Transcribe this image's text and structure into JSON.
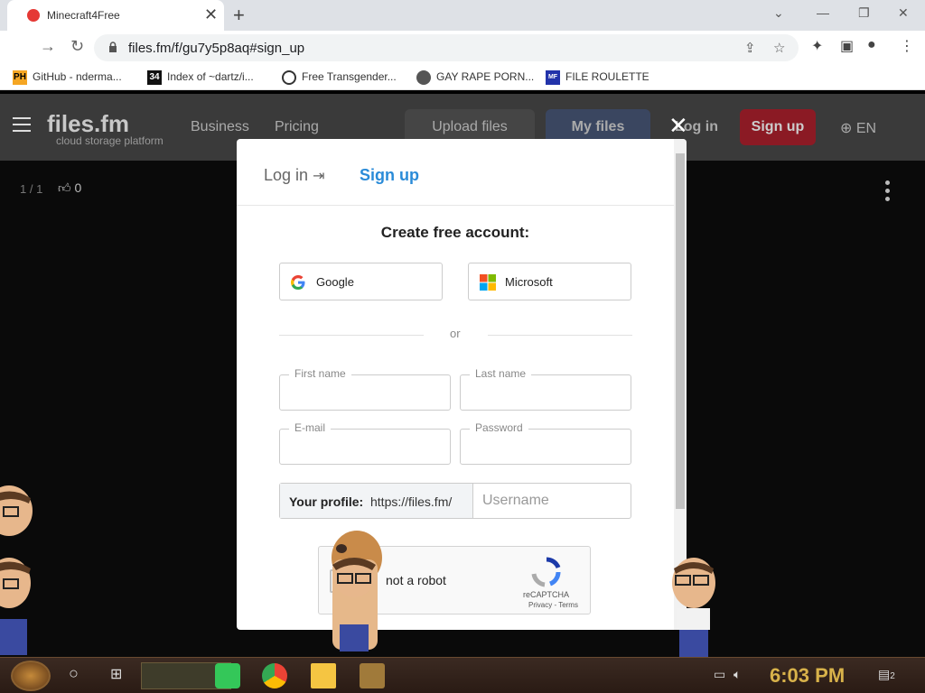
{
  "browser": {
    "tab_title": "Minecraft4Free",
    "tab_close": "✕",
    "new_tab": "+",
    "url": "files.fm/f/gu7y5p8aq#sign_up",
    "bookmarks": [
      {
        "icon_text": "PH",
        "label": "GitHub - ndermа..."
      },
      {
        "icon_text": "34",
        "label": "Index of ~dartz/i..."
      },
      {
        "icon_text": "",
        "label": "Free Transgender..."
      },
      {
        "icon_text": "",
        "label": "GAY RAPE PORN..."
      },
      {
        "icon_text": "MF",
        "label": "FILE ROULETTE"
      }
    ]
  },
  "site": {
    "logo": "files.fm",
    "logo_tag": "cloud storage platform",
    "nav": [
      "Business",
      "Pricing"
    ],
    "upload_label": "Upload files",
    "myfiles_label": "My files",
    "login_label": "Log in",
    "signup_label": "Sign up",
    "lang_label": "EN",
    "counter": "1 / 1",
    "likes": "0"
  },
  "modal": {
    "close": "✕",
    "tab_login": "Log in",
    "tab_signup": "Sign up",
    "heading": "Create free account:",
    "google_label": "Google",
    "microsoft_label": "Microsoft",
    "or_text": "or",
    "fields": {
      "first_name": "First name",
      "last_name": "Last name",
      "email": "E-mail",
      "password": "Password"
    },
    "profile_label": "Your profile:",
    "profile_url": "https://files.fm/",
    "username_placeholder": "Username",
    "captcha_text": "not a robot",
    "captcha_brand": "reCAPTCHA",
    "captcha_links": "Privacy - Terms"
  },
  "taskbar": {
    "time": "6:03 PM",
    "notifications": "2"
  },
  "colors": {
    "accent_blue": "#2a8bd8",
    "signup_red": "#8b1a24",
    "myfiles_blue": "#3a4660",
    "taskbar_gold": "#d8b24a"
  }
}
